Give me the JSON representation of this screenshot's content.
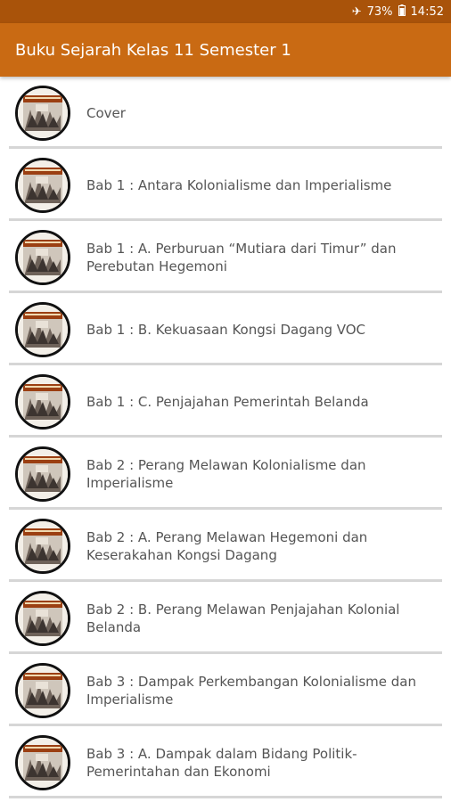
{
  "status_bar": {
    "airplane_icon": "airplane-icon",
    "battery_percent": "73%",
    "battery_icon": "battery-icon",
    "time": "14:52"
  },
  "app_bar": {
    "title": "Buku Sejarah Kelas 11 Semester 1"
  },
  "items": [
    {
      "label": "Cover"
    },
    {
      "label": "Bab 1 : Antara Kolonialisme dan Imperialisme"
    },
    {
      "label": "Bab 1 : A. Perburuan “Mutiara dari Timur” dan Perebutan Hegemoni"
    },
    {
      "label": "Bab 1 : B. Kekuasaan Kongsi Dagang VOC"
    },
    {
      "label": "Bab 1 : C. Penjajahan Pemerintah Belanda"
    },
    {
      "label": "Bab 2 : Perang Melawan Kolonialisme dan Imperialisme"
    },
    {
      "label": "Bab 2 : A. Perang Melawan Hegemoni dan Keserakahan Kongsi Dagang"
    },
    {
      "label": "Bab 2 : B. Perang Melawan Penjajahan Kolonial Belanda"
    },
    {
      "label": "Bab 3 : Dampak Perkembangan Kolonialisme dan Imperialisme"
    },
    {
      "label": "Bab 3 : A. Dampak dalam Bidang Politik-Pemerintahan dan Ekonomi"
    }
  ],
  "colors": {
    "status_bar": "#a9530a",
    "app_bar": "#c96a13",
    "text": "#555555",
    "divider": "#d6d6d6"
  }
}
